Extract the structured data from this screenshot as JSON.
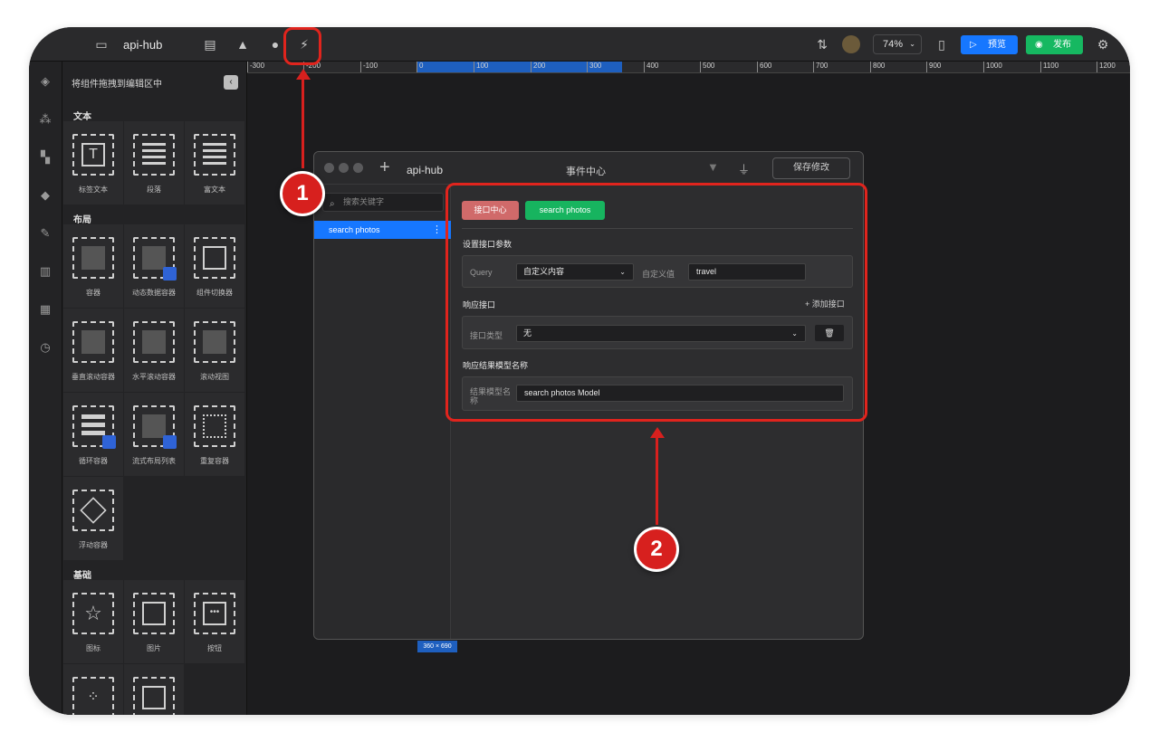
{
  "app": {
    "title": "api-hub",
    "zoom": "74%",
    "preview_label": "预览",
    "publish_label": "发布"
  },
  "panel": {
    "title": "将组件拖拽到编辑区中",
    "sections": [
      {
        "label": "文本",
        "items": [
          "标签文本",
          "段落",
          "富文本"
        ]
      },
      {
        "label": "布局",
        "items": [
          "容器",
          "动态数据容器",
          "组件切换器",
          "垂直滚动容器",
          "水平滚动容器",
          "滚动视图",
          "循环容器",
          "流式布局列表",
          "重复容器",
          "浮动容器"
        ]
      },
      {
        "label": "基础",
        "items": [
          "图标",
          "图片",
          "按钮"
        ]
      }
    ]
  },
  "ruler": {
    "ticks": [
      "-300",
      "-200",
      "-100",
      "0",
      "100",
      "200",
      "300",
      "400",
      "500",
      "600",
      "700",
      "800",
      "900",
      "1000",
      "1100",
      "1200"
    ]
  },
  "dialog": {
    "name": "api-hub",
    "title": "事件中心",
    "save_label": "保存修改",
    "search_placeholder": "搜索关键字",
    "list": [
      "search photos"
    ],
    "tabs": [
      "接口中心",
      "search photos"
    ],
    "params_heading": "设置接口参数",
    "query_label": "Query",
    "query_select": "自定义内容",
    "custom_label": "自定义值",
    "custom_value": "travel",
    "response_heading": "响应接口",
    "add_link": "添加接口",
    "api_type_label": "接口类型",
    "api_type_value": "无",
    "model_heading": "响应结果模型名称",
    "model_label": "结果模型名称",
    "model_value": "search photos Model"
  },
  "canvas": {
    "size_badge": "360 × 690"
  },
  "annotations": {
    "callout_1": "1",
    "callout_2": "2"
  }
}
